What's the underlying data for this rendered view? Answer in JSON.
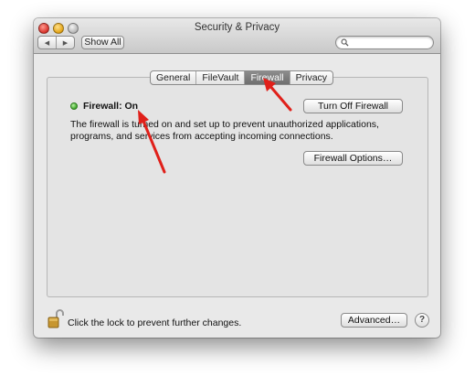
{
  "window": {
    "title": "Security & Privacy"
  },
  "toolbar": {
    "back_icon": "back-arrow-icon",
    "forward_icon": "forward-arrow-icon",
    "show_all_label": "Show All",
    "search_placeholder": ""
  },
  "tabs": [
    {
      "label": "General",
      "active": false
    },
    {
      "label": "FileVault",
      "active": false
    },
    {
      "label": "Firewall",
      "active": true
    },
    {
      "label": "Privacy",
      "active": false
    }
  ],
  "firewall": {
    "status_label": "Firewall: On",
    "status_color": "#3fa62c",
    "description": "The firewall is turned on and set up to prevent unauthorized applications, programs, and services from accepting incoming connections.",
    "turn_off_label": "Turn Off Firewall",
    "options_label": "Firewall Options…"
  },
  "footer": {
    "lock_text": "Click the lock to prevent further changes.",
    "advanced_label": "Advanced…",
    "help_label": "?"
  },
  "annotations": {
    "arrow_color": "#e0201a"
  }
}
